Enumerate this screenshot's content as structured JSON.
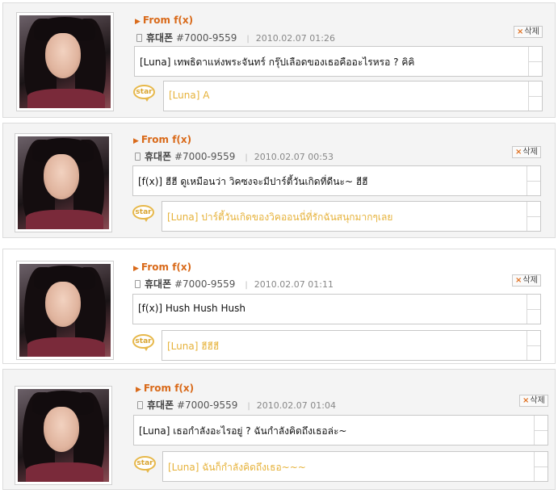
{
  "entries": [
    {
      "from_label": "From f(x)",
      "device_name": "휴대폰",
      "phone_number": "#7000-9559",
      "timestamp": "2010.02.07 01:26",
      "delete_label": "삭제",
      "message": "[Luna] เทพธิดาแห่งพระจันทร์ กรุ๊ปเลือดของเธอคืออะไรหรอ ? คิคิ",
      "reply_icon_label": "star",
      "reply": "[Luna] A"
    },
    {
      "from_label": "From f(x)",
      "device_name": "휴대폰",
      "phone_number": "#7000-9559",
      "timestamp": "2010.02.07 00:53",
      "delete_label": "삭제",
      "message": "[f(x)] ฮีฮี ดูเหมือนว่า วิคซงจะมีปาร์ตี้วันเกิดที่ดีนะ~ ฮีฮี",
      "reply_icon_label": "star",
      "reply": "[Luna] ปาร์ตี้วันเกิดของวิคออนนี่ที่รักฉันสนุกมากๆเลย"
    },
    {
      "from_label": "From f(x)",
      "device_name": "휴대폰",
      "phone_number": "#7000-9559",
      "timestamp": "2010.02.07 01:11",
      "delete_label": "삭제",
      "message": "[f(x)] Hush Hush Hush",
      "reply_icon_label": "star",
      "reply": "[Luna] ฮีฮีฮี"
    },
    {
      "from_label": "From f(x)",
      "device_name": "휴대폰",
      "phone_number": "#7000-9559",
      "timestamp": "2010.02.07 01:04",
      "delete_label": "삭제",
      "message": "[Luna] เธอกำลังอะไรอยู่ ? ฉันกำลังคิดถึงเธอล่ะ~",
      "reply_icon_label": "star",
      "reply": "[Luna] ฉันก็กำลังคิดถึงเธอ~~~"
    }
  ]
}
